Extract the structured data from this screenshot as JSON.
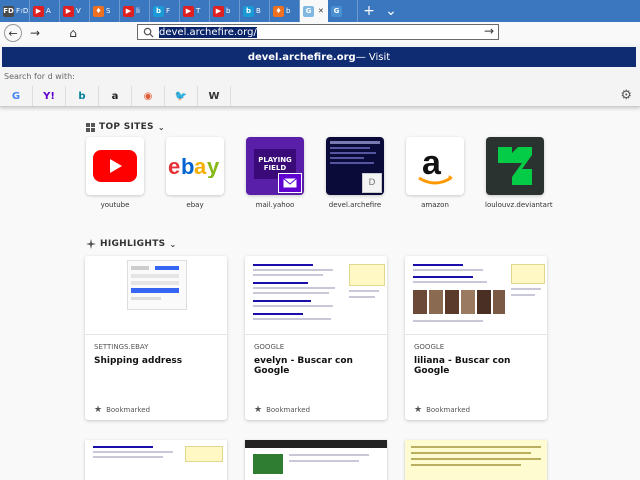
{
  "tabs": [
    {
      "glyph": "FD",
      "color": "#4a4a4a",
      "label": "F₇DX"
    },
    {
      "glyph": "▶",
      "color": "#e02020",
      "label": "A"
    },
    {
      "glyph": "▶",
      "color": "#e02020",
      "label": "V"
    },
    {
      "glyph": "♦",
      "color": "#f07020",
      "label": "S"
    },
    {
      "glyph": "▶",
      "color": "#e02020",
      "label": "li"
    },
    {
      "glyph": "b",
      "color": "#1a9ad6",
      "label": "F"
    },
    {
      "glyph": "▶",
      "color": "#e02020",
      "label": "T"
    },
    {
      "glyph": "▶",
      "color": "#e02020",
      "label": "b"
    },
    {
      "glyph": "b",
      "color": "#1a9ad6",
      "label": "B"
    },
    {
      "glyph": "♦",
      "color": "#f07020",
      "label": "b"
    },
    {
      "glyph": "G",
      "color": "#7fb8e0",
      "label": ""
    },
    {
      "glyph": "G",
      "color": "#4a90d0",
      "label": ""
    }
  ],
  "tabbar": {
    "close": "✕",
    "new_tab": "+",
    "list": "⌄"
  },
  "navbar": {
    "back": "←",
    "forward": "→",
    "home": "⌂"
  },
  "urlbar": {
    "value": "devel.archefire.org/",
    "go": "→"
  },
  "toolbar": {
    "library": "⫼",
    "sidebar": "▥",
    "menu": "≡"
  },
  "dropdown": {
    "suggestion_bold": "devel.archefire.org",
    "suggestion_rest": " — Visit",
    "search_for": "Search for d with:",
    "engines": [
      {
        "glyph": "G",
        "color": "#4285f4"
      },
      {
        "glyph": "Y!",
        "color": "#6001d2"
      },
      {
        "glyph": "b",
        "color": "#00809d"
      },
      {
        "glyph": "a",
        "color": "#222"
      },
      {
        "glyph": "◉",
        "color": "#de5833"
      },
      {
        "glyph": "🐦",
        "color": "#1da1f2"
      },
      {
        "glyph": "W",
        "color": "#333"
      }
    ],
    "settings": "⚙"
  },
  "top_sites": {
    "title": "TOP SITES",
    "sites": [
      {
        "label": "youtube"
      },
      {
        "label": "ebay"
      },
      {
        "label": "mail.yahoo"
      },
      {
        "label": "devel.archefire"
      },
      {
        "label": "amazon"
      },
      {
        "label": "loulouvz.deviantart"
      }
    ],
    "yahoo_text": "PLAYING FIELD",
    "devel_letter": "D"
  },
  "highlights": {
    "title": "HIGHLIGHTS",
    "cards": [
      {
        "source": "SETTINGS.EBAY",
        "title": "Shipping address",
        "status": "Bookmarked"
      },
      {
        "source": "GOOGLE",
        "title": "evelyn - Buscar con Google",
        "status": "Bookmarked"
      },
      {
        "source": "GOOGLE",
        "title": "liliana - Buscar con Google",
        "status": "Bookmarked"
      }
    ]
  },
  "colors": {
    "tabbar": "#3b77bf",
    "suggestion": "#0f2c73",
    "youtube": "#ff0000",
    "deviantart": "#05cc47"
  }
}
